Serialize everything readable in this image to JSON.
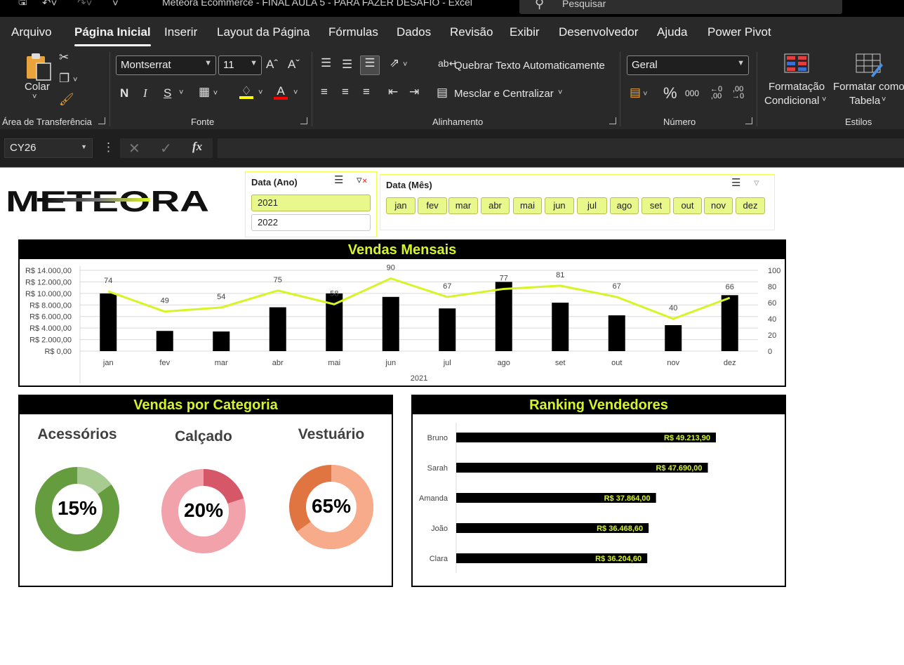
{
  "titlebar": {
    "title": "Meteora Ecommerce - FINAL AULA 5 - PARA FAZER DESAFIO  -  Excel",
    "search_placeholder": "Pesquisar"
  },
  "menu": [
    "Arquivo",
    "Página Inicial",
    "Inserir",
    "Layout da Página",
    "Fórmulas",
    "Dados",
    "Revisão",
    "Exibir",
    "Desenvolvedor",
    "Ajuda",
    "Power Pivot"
  ],
  "ribbon": {
    "clipboard": {
      "paste": "Colar",
      "group": "Área de Transferência"
    },
    "font": {
      "name": "Montserrat",
      "size": "11",
      "group": "Fonte",
      "bold": "N",
      "italic": "I",
      "underline": "S"
    },
    "alignment": {
      "wrap": "Quebrar Texto Automaticamente",
      "merge": "Mesclar e Centralizar",
      "group": "Alinhamento"
    },
    "number": {
      "format": "Geral",
      "group": "Número",
      "percent": "%",
      "thousands": "000"
    },
    "styles": {
      "cond1": "Formatação",
      "cond2": "Condicional",
      "table1": "Formatar como",
      "table2": "Tabela",
      "group": "Estilos"
    }
  },
  "formula_bar": {
    "name_box": "CY26",
    "fx": "fx",
    "value": ""
  },
  "dashboard": {
    "logo": "METEORA",
    "slicer_year": {
      "title": "Data (Ano)",
      "items": [
        "2021",
        "2022"
      ],
      "selected": "2021"
    },
    "slicer_month": {
      "title": "Data (Mês)",
      "items": [
        "jan",
        "fev",
        "mar",
        "abr",
        "mai",
        "jun",
        "jul",
        "ago",
        "set",
        "out",
        "nov",
        "dez"
      ]
    },
    "monthly_title": "Vendas Mensais",
    "category_title": "Vendas por Categoria",
    "ranking_title": "Ranking Vendedores",
    "categories": [
      {
        "name": "Acessórios",
        "pct": "15%",
        "value": 0.15,
        "main": "#659c3e",
        "light": "#a8cb92"
      },
      {
        "name": "Calçado",
        "pct": "20%",
        "value": 0.2,
        "main": "#f2a2aa",
        "light": "#d65868"
      },
      {
        "name": "Vestuário",
        "pct": "65%",
        "value": 0.65,
        "main": "#e17541",
        "light": "#f7ab8b"
      }
    ]
  },
  "chart_data": [
    {
      "type": "bar",
      "title": "Vendas Mensais",
      "xlabel": "2021",
      "categories": [
        "jan",
        "fev",
        "mar",
        "abr",
        "mai",
        "jun",
        "jul",
        "ago",
        "set",
        "out",
        "nov",
        "dez"
      ],
      "y_ticks": [
        "R$ 0,00",
        "R$ 2.000,00",
        "R$ 4.000,00",
        "R$ 6.000,00",
        "R$ 8.000,00",
        "R$ 10.000,00",
        "R$ 12.000,00",
        "R$ 14.000,00"
      ],
      "ylim": [
        0,
        14000
      ],
      "y2_ticks": [
        "0",
        "20",
        "40",
        "60",
        "80",
        "100"
      ],
      "y2lim": [
        0,
        100
      ],
      "series": [
        {
          "type": "bar",
          "values": [
            10000,
            3500,
            3400,
            7600,
            10000,
            9400,
            7400,
            12000,
            8400,
            6200,
            4500,
            9700
          ],
          "color": "#000000"
        },
        {
          "type": "line",
          "values": [
            74,
            49,
            54,
            75,
            58,
            90,
            67,
            77,
            81,
            67,
            40,
            66
          ],
          "labels": [
            "74",
            "49",
            "54",
            "75",
            "58",
            "90",
            "67",
            "77",
            "81",
            "67",
            "40",
            "66"
          ],
          "color": "#d7f526"
        }
      ],
      "grid": true
    },
    {
      "type": "bar",
      "orientation": "horizontal",
      "title": "Ranking Vendedores",
      "categories": [
        "Bruno",
        "Sarah",
        "Amanda",
        "João",
        "Clara"
      ],
      "values": [
        49213.9,
        47690.0,
        37864.0,
        36468.6,
        36204.6
      ],
      "labels": [
        "R$ 49.213,90",
        "R$ 47.690,00",
        "R$ 37.864,00",
        "R$ 36.468,60",
        "R$ 36.204,60"
      ],
      "bar_color": "#000000",
      "label_color": "#d7f526"
    }
  ]
}
